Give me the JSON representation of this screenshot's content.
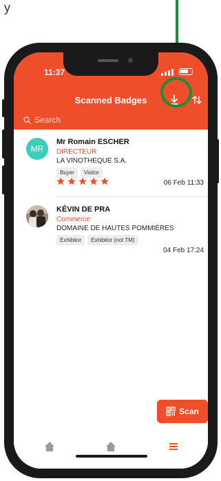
{
  "instruction": {
    "text": "y"
  },
  "status": {
    "time": "11:37"
  },
  "header": {
    "title": "Scanned Badges",
    "search_placeholder": "Search"
  },
  "badges": [
    {
      "initials": "MR",
      "name": "Mr Romain ESCHER",
      "title": "DIRECTEUR",
      "company": "LA VINOTHEQUE S.A.",
      "tags": [
        "Buyer",
        "Visitor"
      ],
      "rating": 5,
      "date": "06 Feb 11:33"
    },
    {
      "name": "KÉVIN DE PRA",
      "title": "Commerce",
      "company": "DOMAINE DE HAUTES POMMIÈRES",
      "tags": [
        "Exhibitor",
        "Exhibitor (not TM)"
      ],
      "date": "04 Feb 17:24"
    }
  ],
  "scan_button": {
    "label": "Scan"
  },
  "colors": {
    "accent": "#ee4f2a",
    "avatar": "#3ccdbd",
    "annotation": "#1a8c3c"
  },
  "icons": {
    "download": "download-icon",
    "sort": "sort-icon",
    "search": "search-icon",
    "qr": "qr-code-icon",
    "home": "home-icon",
    "menu": "hamburger-menu-icon",
    "star": "star-icon"
  }
}
